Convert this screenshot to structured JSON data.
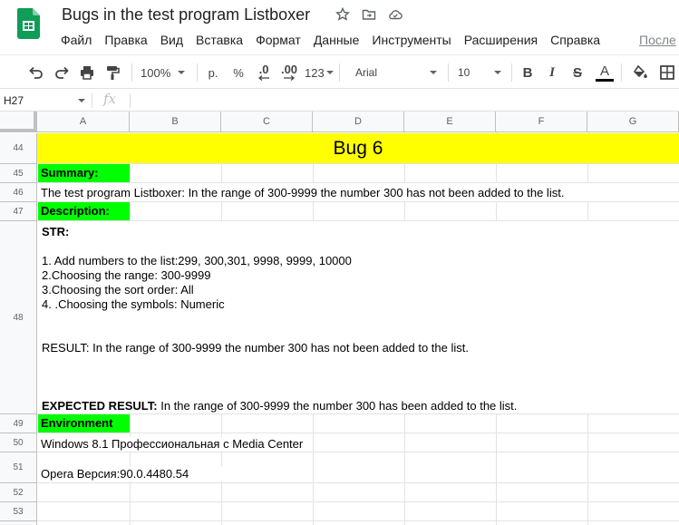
{
  "doc": {
    "title": "Bugs in the test program Listboxer"
  },
  "menu": {
    "items": [
      "Файл",
      "Правка",
      "Вид",
      "Вставка",
      "Формат",
      "Данные",
      "Инструменты",
      "Расширения",
      "Справка"
    ],
    "last_edit": "После"
  },
  "toolbar": {
    "zoom": "100%",
    "currency": "р.",
    "percent": "%",
    "dec_decrease": ".0",
    "dec_increase": ".00",
    "number_format": "123",
    "font": "Arial",
    "font_size": "10",
    "bold": "B",
    "italic": "I",
    "strike": "S",
    "text_color": "A"
  },
  "formula_bar": {
    "cell_ref": "H27",
    "fx": "fx",
    "content": ""
  },
  "grid": {
    "columns": [
      "A",
      "B",
      "C",
      "D",
      "E",
      "F",
      "G"
    ],
    "rows": [
      "44",
      "45",
      "46",
      "47",
      "48",
      "49",
      "50",
      "51",
      "52",
      "53"
    ]
  },
  "sheet": {
    "bug_title": "Bug 6",
    "summary_label": "Summary:",
    "summary_text": "The test program Listboxer: In the range of 300-9999 the number 300 has not been added to the list.",
    "description_label": "Description:",
    "str_label": "STR:",
    "steps": [
      "1. Add numbers to the list:299, 300,301, 9998, 9999, 10000",
      "2.Choosing the range: 300-9999",
      "3.Choosing the sort order: All",
      "4. .Choosing the symbols: Numeric"
    ],
    "result": "RESULT: In the range of 300-9999 the number 300 has not been added to the list.",
    "expected_label": "EXPECTED RESULT:",
    "expected_text": " In the range of 300-9999 the number 300 has been added to the list.",
    "environment_label": "Environment",
    "env_os": "Windows 8.1 Профессиональная с  Media Center",
    "env_browser": "Opera  Версия:90.0.4480.54"
  },
  "colors": {
    "yellow": "#ffff00",
    "green": "#00ff00",
    "header_bg": "#f8f9fa",
    "sheets_green": "#0f9d58"
  }
}
